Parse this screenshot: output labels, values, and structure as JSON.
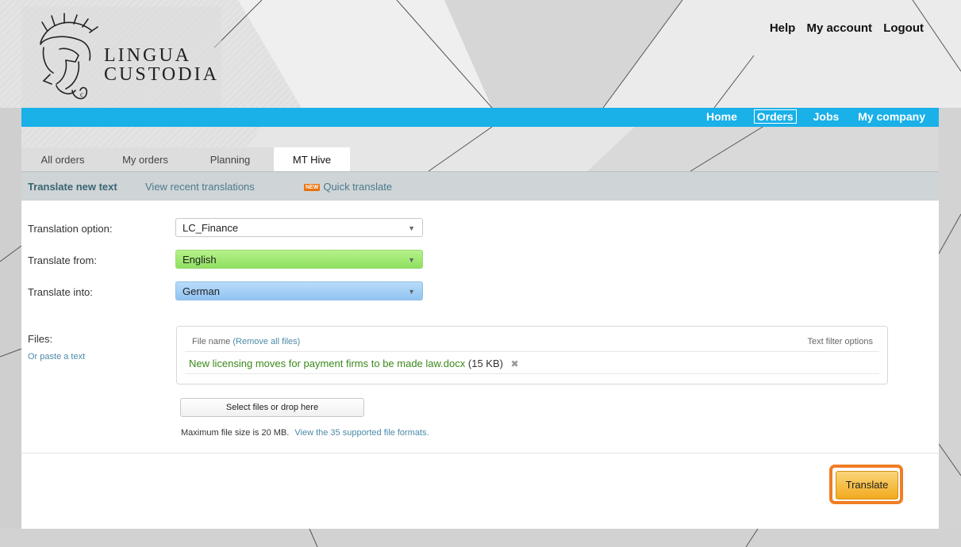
{
  "brand": {
    "line1": "LINGUA",
    "line2": "CUSTODIA"
  },
  "top_links": [
    "Help",
    "My account",
    "Logout"
  ],
  "nav": {
    "items": [
      "Home",
      "Orders",
      "Jobs",
      "My company"
    ],
    "active": "Orders"
  },
  "tabs": [
    "All orders",
    "My orders",
    "Planning",
    "MT Hive"
  ],
  "active_tab": "MT Hive",
  "subnav": {
    "item1": "Translate new text",
    "item2": "View recent translations",
    "badge": "NEW",
    "item3": "Quick translate"
  },
  "form": {
    "option_label": "Translation option:",
    "option_value": "LC_Finance",
    "from_label": "Translate from:",
    "from_value": "English",
    "into_label": "Translate into:",
    "into_value": "German",
    "files_label": "Files:",
    "paste_link": "Or paste a text"
  },
  "files": {
    "header_label": "File name",
    "remove_all": "(Remove all files)",
    "filter_options": "Text filter options",
    "file_name": "New licensing moves for payment firms to be made law.docx",
    "file_size": "(15 KB)"
  },
  "upload": {
    "button": "Select files or drop here",
    "max_text": "Maximum file size is 20 MB.",
    "formats_link": "View the 35 supported file formats."
  },
  "translate_button": "Translate",
  "colors": {
    "nav_bg": "#1ab0e8",
    "accent_orange": "#f07d24",
    "green_select": "#8fe060",
    "blue_select": "#91c3f1"
  }
}
